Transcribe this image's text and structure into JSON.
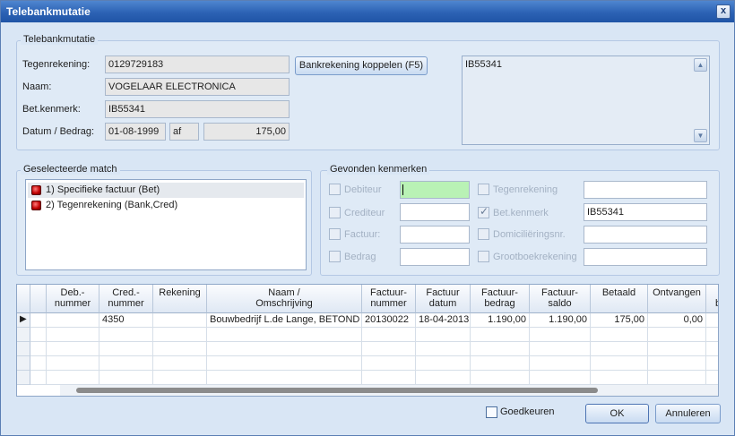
{
  "window": {
    "title": "Telebankmutatie",
    "close_symbol": "x"
  },
  "telebank": {
    "group_title": "Telebankmutatie",
    "tegenrekening_label": "Tegenrekening:",
    "tegenrekening_value": "0129729183",
    "koppelen_button": "Bankrekening koppelen (F5)",
    "naam_label": "Naam:",
    "naam_value": "VOGELAAR ELECTRONICA",
    "betkenmerk_label": "Bet.kenmerk:",
    "betkenmerk_value": "IB55341",
    "datum_label": "Datum / Bedrag:",
    "datum_value": "01-08-1999",
    "af_value": "af",
    "bedrag_value": "175,00",
    "memo_value": "IB55341"
  },
  "match": {
    "group_title": "Geselecteerde match",
    "items": [
      {
        "label": "1) Specifieke factuur (Bet)"
      },
      {
        "label": "2) Tegenrekening (Bank,Cred)"
      }
    ]
  },
  "kenmerken": {
    "group_title": "Gevonden kenmerken",
    "left": [
      {
        "label": "Debiteur",
        "value": "",
        "checked": false
      },
      {
        "label": "Crediteur",
        "value": "",
        "checked": false
      },
      {
        "label": "Factuur:",
        "value": "",
        "checked": false
      },
      {
        "label": "Bedrag",
        "value": "",
        "checked": false
      }
    ],
    "right": [
      {
        "label": "Tegenrekening",
        "value": "",
        "checked": false
      },
      {
        "label": "Bet.kenmerk",
        "value": "IB55341",
        "checked": true
      },
      {
        "label": "Domiciliëringsnr.",
        "value": "",
        "checked": false
      },
      {
        "label": "Grootboekrekening",
        "value": "",
        "checked": false
      }
    ]
  },
  "grid": {
    "columns": [
      {
        "line1": "Deb.-",
        "line2": "nummer"
      },
      {
        "line1": "Cred.-",
        "line2": "nummer"
      },
      {
        "line1": "Rekening",
        "line2": ""
      },
      {
        "line1": "Naam /",
        "line2": "Omschrijving"
      },
      {
        "line1": "Factuur-",
        "line2": "nummer"
      },
      {
        "line1": "Factuur",
        "line2": "datum"
      },
      {
        "line1": "Factuur-",
        "line2": "bedrag"
      },
      {
        "line1": "Factuur-",
        "line2": "saldo"
      },
      {
        "line1": "Betaald",
        "line2": ""
      },
      {
        "line1": "Ontvangen",
        "line2": ""
      },
      {
        "line1": "",
        "line2": "b"
      }
    ],
    "rows": [
      [
        "",
        "4350",
        "",
        "Bouwbedrijf L.de Lange, BETOND",
        "20130022",
        "18-04-2013",
        "1.190,00",
        "1.190,00",
        "175,00",
        "0,00",
        ""
      ]
    ],
    "current_row_marker": "▶"
  },
  "footer": {
    "goedkeuren_label": "Goedkeuren",
    "ok_label": "OK",
    "annuleren_label": "Annuleren"
  },
  "colors": {
    "titlebar": "#2c62b4",
    "highlight_field": "#b9f2b5",
    "window_bg": "#d9e6f5"
  }
}
